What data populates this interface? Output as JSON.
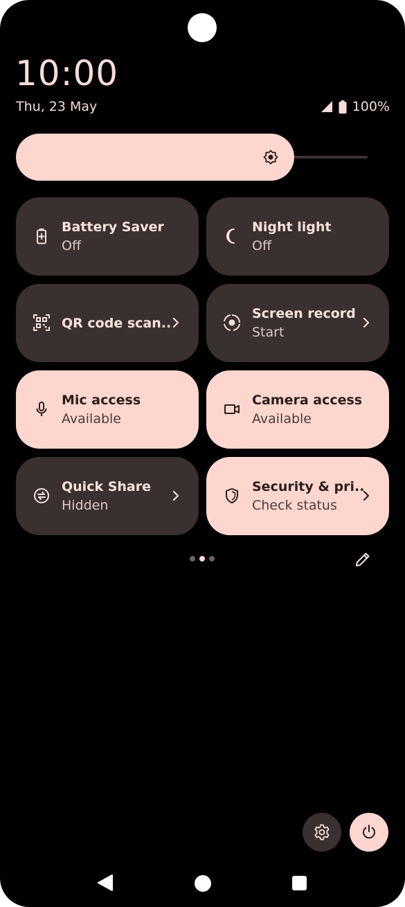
{
  "status_bar": {
    "time": "10:00",
    "date": "Thu, 23 May",
    "battery": "100%"
  },
  "brightness": {
    "level": 0.72
  },
  "tiles": [
    {
      "title": "Battery Saver",
      "subtitle": "Off",
      "state": "off",
      "icon": "battery-saver-icon",
      "chevron": false
    },
    {
      "title": "Night light",
      "subtitle": "Off",
      "state": "off",
      "icon": "night-light-icon",
      "chevron": false
    },
    {
      "title": "QR code scan..",
      "subtitle": "",
      "state": "off",
      "icon": "qr-scan-icon",
      "chevron": true
    },
    {
      "title": "Screen record",
      "subtitle": "Start",
      "state": "off",
      "icon": "screen-record-icon",
      "chevron": true
    },
    {
      "title": "Mic access",
      "subtitle": "Available",
      "state": "on",
      "icon": "mic-icon",
      "chevron": false
    },
    {
      "title": "Camera access",
      "subtitle": "Available",
      "state": "on",
      "icon": "camera-icon",
      "chevron": false
    },
    {
      "title": "Quick Share",
      "subtitle": "Hidden",
      "state": "off",
      "icon": "quick-share-icon",
      "chevron": true
    },
    {
      "title": "Security & pri..",
      "subtitle": "Check status",
      "state": "on",
      "icon": "shield-icon",
      "chevron": true
    }
  ],
  "pager": {
    "pages": 3,
    "active_page": 2
  },
  "colors": {
    "accent": "#fdd7cf",
    "tile_dark": "#3a302f",
    "text_light": "#f7dcd8"
  }
}
